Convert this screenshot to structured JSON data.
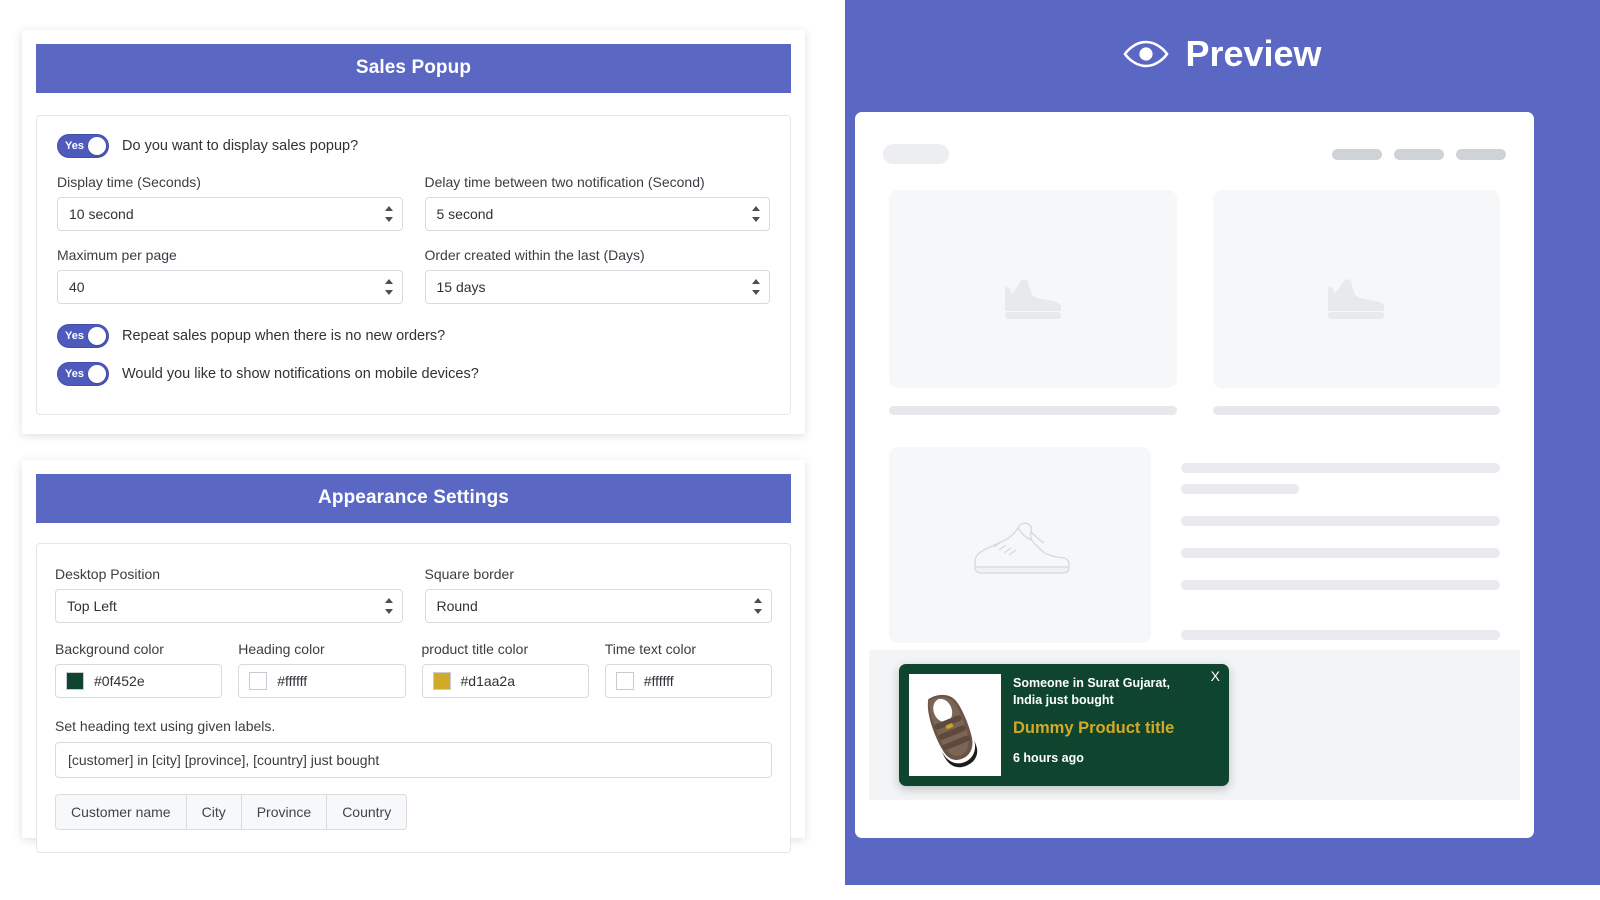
{
  "sales_popup": {
    "header_title": "Sales Popup",
    "enable_toggle": {
      "state_label": "Yes",
      "question": "Do you want to display sales popup?"
    },
    "display_time": {
      "label": "Display time (Seconds)",
      "value": "10 second"
    },
    "delay_time": {
      "label": "Delay time between two notification (Second)",
      "value": "5 second"
    },
    "max_per_page": {
      "label": "Maximum per page",
      "value": "40"
    },
    "order_window": {
      "label": "Order created within the last (Days)",
      "value": "15 days"
    },
    "repeat_toggle": {
      "state_label": "Yes",
      "question": "Repeat sales popup when there is no new orders?"
    },
    "mobile_toggle": {
      "state_label": "Yes",
      "question": "Would you like to show notifications on mobile devices?"
    }
  },
  "appearance": {
    "header_title": "Appearance Settings",
    "desktop_position": {
      "label": "Desktop Position",
      "value": "Top Left"
    },
    "square_border": {
      "label": "Square border",
      "value": "Round"
    },
    "colors": [
      {
        "label": "Background color",
        "value": "#0f452e",
        "swatch": "#0f452e"
      },
      {
        "label": "Heading color",
        "value": "#ffffff",
        "swatch": "#ffffff"
      },
      {
        "label": "product title color",
        "value": "#d1aa2a",
        "swatch": "#d1aa2a"
      },
      {
        "label": "Time text color",
        "value": "#ffffff",
        "swatch": "#ffffff"
      }
    ],
    "heading_text": {
      "label": "Set heading text using given labels.",
      "value": "[customer] in [city] [province], [country] just bought"
    },
    "label_buttons": [
      "Customer name",
      "City",
      "Province",
      "Country"
    ]
  },
  "preview": {
    "title": "Preview",
    "eye_icon": "eye-icon",
    "notification": {
      "heading": "Someone in Surat Gujarat, India just bought",
      "product_title": "Dummy Product title",
      "time_text": "6 hours ago",
      "close_label": "X",
      "background_color": "#0f452e",
      "product_title_color": "#d1aa2a",
      "heading_color": "#ffffff",
      "time_color": "#ffffff"
    }
  },
  "theme": {
    "accent": "#5a68c4",
    "toggle_on": "#4e5bbd",
    "skeleton_light": "#f6f7f9",
    "skeleton_bar": "#e8eaed"
  }
}
